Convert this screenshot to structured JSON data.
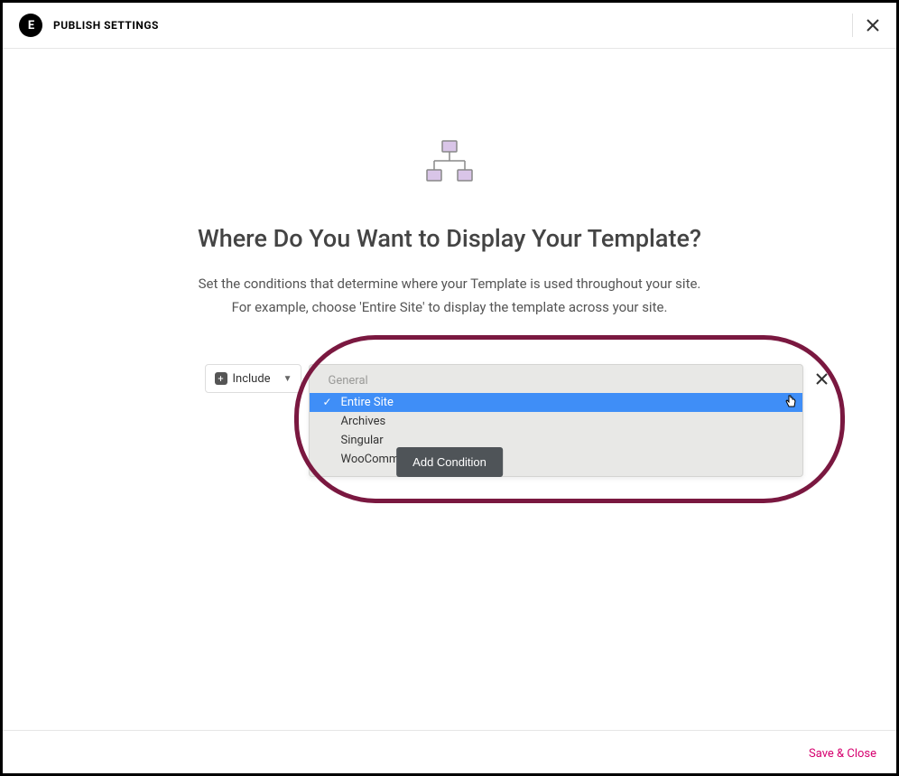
{
  "header": {
    "logo_text": "E",
    "title": "PUBLISH SETTINGS"
  },
  "main": {
    "heading": "Where Do You Want to Display Your Template?",
    "description_line1": "Set the conditions that determine where your Template is used throughout your site.",
    "description_line2": "For example, choose 'Entire Site' to display the template across your site."
  },
  "condition": {
    "include_label": "Include",
    "dropdown": {
      "group_label": "General",
      "options": [
        {
          "label": "Entire Site",
          "selected": true
        },
        {
          "label": "Archives",
          "selected": false
        },
        {
          "label": "Singular",
          "selected": false
        },
        {
          "label": "WooCommerce",
          "selected": false
        }
      ]
    }
  },
  "buttons": {
    "add_condition": "Add Condition",
    "save_close": "Save & Close"
  }
}
